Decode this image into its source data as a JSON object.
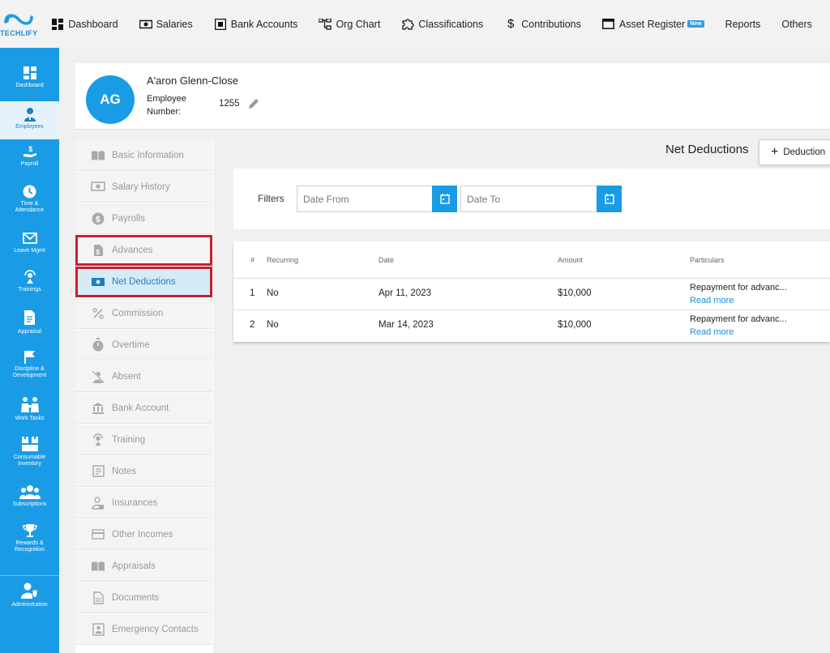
{
  "brand": {
    "name": "TECHLIFY",
    "color": "#1a9be6"
  },
  "topnav": [
    {
      "label": "Dashboard",
      "icon": "dashboard-icon"
    },
    {
      "label": "Salaries",
      "icon": "money-icon"
    },
    {
      "label": "Bank Accounts",
      "icon": "bank-account-icon"
    },
    {
      "label": "Org Chart",
      "icon": "org-chart-icon"
    },
    {
      "label": "Classifications",
      "icon": "puzzle-icon"
    },
    {
      "label": "Contributions",
      "icon": "dollar-icon"
    },
    {
      "label": "Asset Register",
      "icon": "window-icon",
      "badge": "New"
    },
    {
      "label": "Reports"
    },
    {
      "label": "Others"
    }
  ],
  "sidebar": [
    {
      "label": "Dashboard",
      "icon": "dashboard-icon"
    },
    {
      "label": "Employees",
      "icon": "employees-icon",
      "active": true
    },
    {
      "label": "Payroll",
      "icon": "payroll-icon"
    },
    {
      "label": "Time & Attendance",
      "icon": "clock-icon"
    },
    {
      "label": "Leave Mgmt",
      "icon": "mail-icon"
    },
    {
      "label": "Trainings",
      "icon": "training-icon"
    },
    {
      "label": "Appraisal",
      "icon": "document-icon"
    },
    {
      "label": "Discipline & Development",
      "icon": "flag-icon"
    },
    {
      "label": "Work Tasks",
      "icon": "team-icon"
    },
    {
      "label": "Consumable Inventory",
      "icon": "boxes-icon"
    },
    {
      "label": "Subscriptions",
      "icon": "group-icon"
    },
    {
      "label": "Rewards & Recognition",
      "icon": "trophy-icon"
    },
    {
      "label": "Administration",
      "icon": "admin-icon"
    }
  ],
  "employee": {
    "initials": "AG",
    "name": "A'aron Glenn-Close",
    "number_label": "Employee Number:",
    "number": "1255"
  },
  "submenu": [
    {
      "label": "Basic Information",
      "icon": "book-icon"
    },
    {
      "label": "Salary History",
      "icon": "money-icon"
    },
    {
      "label": "Payrolls",
      "icon": "dollar-circle-icon"
    },
    {
      "label": "Advances",
      "icon": "dollar-file-icon",
      "highlight": true
    },
    {
      "label": "Net Deductions",
      "icon": "cash-icon",
      "active": true
    },
    {
      "label": "Commission",
      "icon": "percent-icon"
    },
    {
      "label": "Overtime",
      "icon": "stopwatch-icon"
    },
    {
      "label": "Absent",
      "icon": "person-off-icon"
    },
    {
      "label": "Bank Account",
      "icon": "bank-icon"
    },
    {
      "label": "Training",
      "icon": "training-icon"
    },
    {
      "label": "Notes",
      "icon": "notes-icon"
    },
    {
      "label": "Insurances",
      "icon": "insurance-icon"
    },
    {
      "label": "Other Incomes",
      "icon": "card-icon"
    },
    {
      "label": "Appraisals",
      "icon": "book-icon"
    },
    {
      "label": "Documents",
      "icon": "document-icon"
    },
    {
      "label": "Emergency Contacts",
      "icon": "contact-icon"
    }
  ],
  "page": {
    "title": "Net Deductions",
    "add_button": "Deduction"
  },
  "filters": {
    "label": "Filters",
    "date_from_placeholder": "Date From",
    "date_to_placeholder": "Date To"
  },
  "table": {
    "headers": [
      "#",
      "Recurring",
      "Date",
      "Amount",
      "Particulars"
    ],
    "rows": [
      {
        "num": "1",
        "recurring": "No",
        "date": "Apr 11, 2023",
        "amount": "$10,000",
        "particulars": "Repayment for advanc...",
        "link": "Read more"
      },
      {
        "num": "2",
        "recurring": "No",
        "date": "Mar 14, 2023",
        "amount": "$10,000",
        "particulars": "Repayment for advanc...",
        "link": "Read more"
      }
    ]
  }
}
